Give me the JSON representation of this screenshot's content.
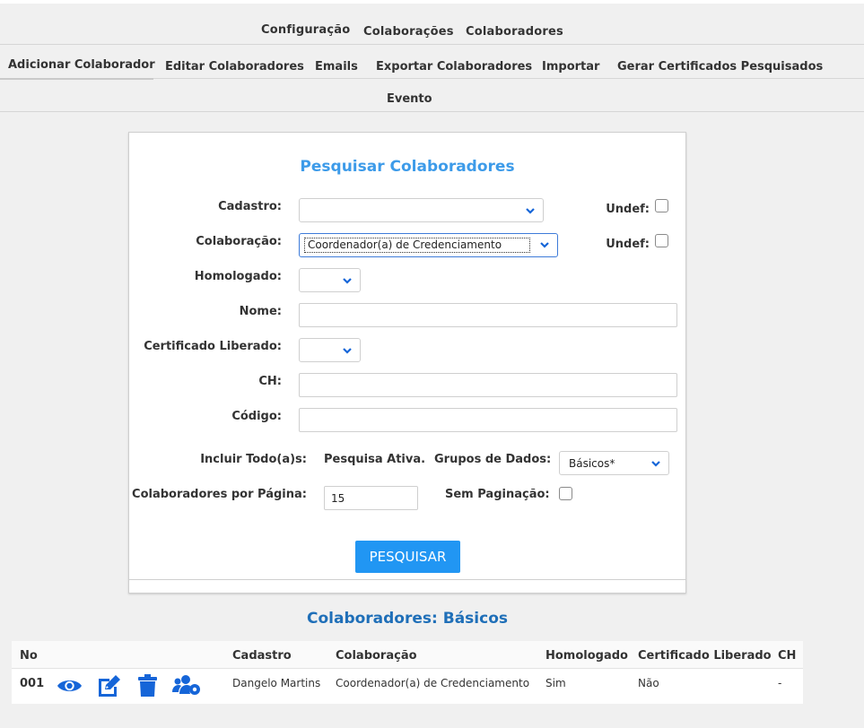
{
  "nav_primary": {
    "tabs": [
      {
        "label": "Configuração"
      },
      {
        "label": "Colaborações"
      },
      {
        "label": "Colaboradores"
      }
    ]
  },
  "nav_secondary": {
    "tabs": [
      {
        "label": "Adicionar Colaborador"
      },
      {
        "label": "Editar Colaboradores"
      },
      {
        "label": "Emails"
      },
      {
        "label": "Exportar Colaboradores"
      },
      {
        "label": "Importar"
      },
      {
        "label": "Gerar Certificados Pesquisados"
      }
    ]
  },
  "nav_tertiary": {
    "tabs": [
      {
        "label": "Evento"
      }
    ]
  },
  "search_form": {
    "title": "Pesquisar Colaboradores",
    "cadastro_label": "Cadastro:",
    "cadastro_value": "",
    "colaboracao_label": "Colaboração:",
    "colaboracao_value": "Coordenador(a) de Credenciamento",
    "undef_label": "Undef:",
    "homologado_label": "Homologado:",
    "homologado_value": "",
    "nome_label": "Nome:",
    "nome_value": "",
    "certificado_label": "Certificado Liberado:",
    "certificado_value": "",
    "ch_label": "CH:",
    "ch_value": "",
    "codigo_label": "Código:",
    "codigo_value": "",
    "incluir_label": "Incluir Todo(a)s:",
    "incluir_value": "Pesquisa Ativa.",
    "grupos_label": "Grupos de Dados:",
    "grupos_value": "Básicos*",
    "por_pagina_label": "Colaboradores por Página:",
    "por_pagina_value": "15",
    "sem_paginacao_label": "Sem Paginação:",
    "search_button": "PESQUISAR"
  },
  "results": {
    "title": "Colaboradores: Básicos",
    "columns": [
      "No",
      "Cadastro",
      "Colaboração",
      "Homologado",
      "Certificado Liberado",
      "CH"
    ],
    "rows": [
      {
        "no": "001",
        "cadastro": "Dangelo Martins",
        "colaboracao": "Coordenador(a) de Credenciamento",
        "homologado": "Sim",
        "certificado": "Não",
        "ch": "-"
      }
    ]
  },
  "colors": {
    "accent": "#2196f3",
    "title_blue": "#3d9be9",
    "results_title": "#1f6fb8",
    "icon_blue": "#1565d8"
  },
  "icons": [
    "chevron-down-icon",
    "eye-icon",
    "edit-icon",
    "trash-icon",
    "users-cog-icon"
  ]
}
